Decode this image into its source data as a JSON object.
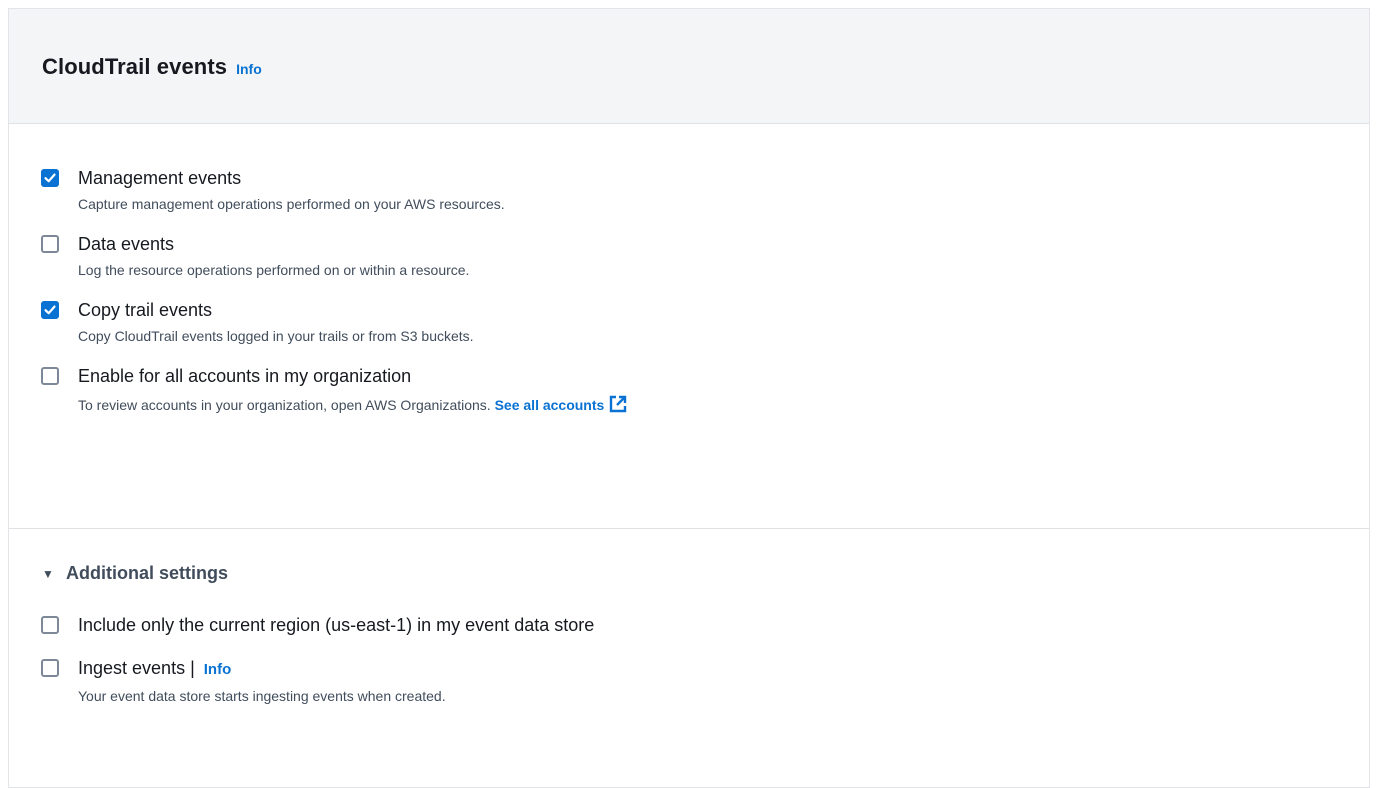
{
  "panel": {
    "title": "CloudTrail events",
    "info_label": "Info"
  },
  "events": [
    {
      "label": "Management events",
      "description": "Capture management operations performed on your AWS resources.",
      "checked": true
    },
    {
      "label": "Data events",
      "description": "Log the resource operations performed on or within a resource.",
      "checked": false
    },
    {
      "label": "Copy trail events",
      "description": "Copy CloudTrail events logged in your trails or from S3 buckets.",
      "checked": true
    },
    {
      "label": "Enable for all accounts in my organization",
      "description": "To review accounts in your organization, open AWS Organizations.",
      "link_text": "See all accounts",
      "checked": false
    }
  ],
  "additional": {
    "expander_label": "Additional settings",
    "expanded": true,
    "region_label": "Include only the current region (us-east-1) in my event data store",
    "region_checked": false,
    "ingest_label": "Ingest events |",
    "ingest_info": "Info",
    "ingest_description": "Your event data store starts ingesting events when created.",
    "ingest_checked": false
  },
  "colors": {
    "accent": "#0972d3",
    "header_bg": "#f4f5f6",
    "border": "#e0e2e5"
  }
}
